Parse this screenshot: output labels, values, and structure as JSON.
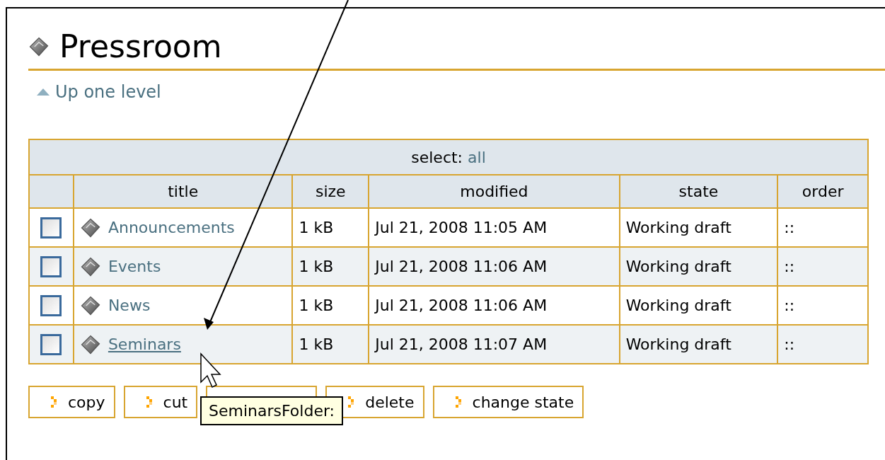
{
  "title": "Pressroom",
  "up_link": "Up one level",
  "table": {
    "select_label": "select:",
    "select_link": "all",
    "columns": [
      "title",
      "size",
      "modified",
      "state",
      "order"
    ],
    "rows": [
      {
        "checked": false,
        "title": "Announcements",
        "hovered": false,
        "size": "1 kB",
        "modified": "Jul 21, 2008 11:05 AM",
        "state": "Working draft",
        "order": "::"
      },
      {
        "checked": false,
        "title": "Events",
        "hovered": false,
        "size": "1 kB",
        "modified": "Jul 21, 2008 11:06 AM",
        "state": "Working draft",
        "order": "::"
      },
      {
        "checked": false,
        "title": "News",
        "hovered": false,
        "size": "1 kB",
        "modified": "Jul 21, 2008 11:06 AM",
        "state": "Working draft",
        "order": "::"
      },
      {
        "checked": false,
        "title": "Seminars",
        "hovered": true,
        "size": "1 kB",
        "modified": "Jul 21, 2008 11:07 AM",
        "state": "Working draft",
        "order": "::"
      }
    ]
  },
  "buttons": [
    {
      "kind": "action",
      "label": "copy"
    },
    {
      "kind": "action",
      "label": "cut"
    },
    {
      "kind": "covered"
    },
    {
      "kind": "action",
      "label": "delete"
    },
    {
      "kind": "action",
      "label": "change state"
    }
  ],
  "tooltip": "SeminarsFolder:"
}
